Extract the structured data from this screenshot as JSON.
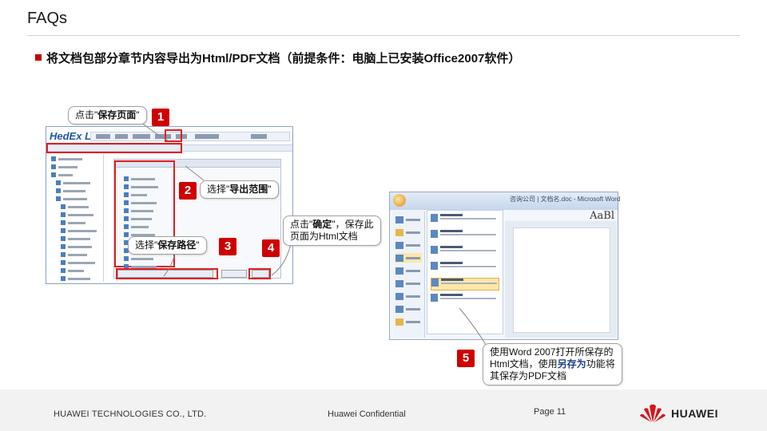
{
  "slide": {
    "title": "FAQs",
    "bullet": "将文档包部分章节内容导出为Html/PDF文档（前提条件：电脑上已安装Office2007软件）"
  },
  "steps": {
    "s1": {
      "number": "1",
      "text_prefix": "点击\"",
      "text_bold": "保存页面",
      "text_suffix": "\""
    },
    "s2": {
      "number": "2",
      "text_prefix": "选择\"",
      "text_bold": "导出范围",
      "text_suffix": "\""
    },
    "s3": {
      "number": "3",
      "text_prefix": "选择\"",
      "text_bold": "保存路径",
      "text_suffix": "\""
    },
    "s4": {
      "number": "4",
      "line1_prefix": "点击\"",
      "line1_bold": "确定",
      "line1_suffix": "\"，保存此",
      "line2": "页面为Html文档"
    },
    "s5": {
      "number": "5",
      "line1": "使用Word 2007打开所保存的",
      "line2_prefix": "Html文档，使用",
      "line2_bold": "另存为",
      "line2_suffix": "功能将",
      "line3": "其保存为PDF文档"
    }
  },
  "app_screenshot": {
    "logo": "HedEx Lite"
  },
  "word_screenshot": {
    "title": "咨询公司 | 文档名.doc - Microsoft Word",
    "style_sample": "AaBl"
  },
  "footer": {
    "company": "HUAWEI TECHNOLOGIES CO., LTD.",
    "confidential": "Huawei Confidential",
    "page": "Page 11",
    "brand": "HUAWEI"
  },
  "colors": {
    "accent": "#d00000",
    "footer_bg": "#f2f2f2"
  }
}
